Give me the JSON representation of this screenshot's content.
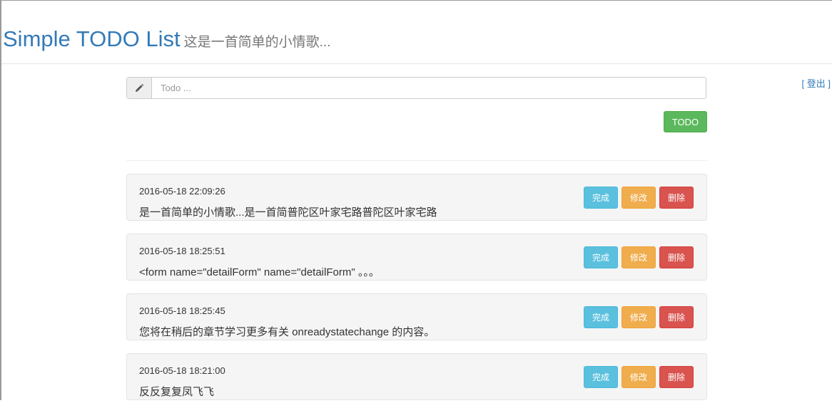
{
  "header": {
    "title": "Simple TODO List",
    "subtitle": "这是一首简单的小情歌..."
  },
  "nav": {
    "logout_label": "[ 登出 ]"
  },
  "form": {
    "input_placeholder": "Todo ...",
    "input_value": "",
    "input_icon": "pencil-icon",
    "submit_label": "TODO"
  },
  "todos": [
    {
      "time": "2016-05-18 22:09:26",
      "text": "是一首简单的小情歌...是一首简普陀区叶家宅路普陀区叶家宅路",
      "done_label": "完成",
      "edit_label": "修改",
      "delete_label": "删除"
    },
    {
      "time": "2016-05-18 18:25:51",
      "text": "<form name=\"detailForm\" name=\"detailForm\" 。。。",
      "done_label": "完成",
      "edit_label": "修改",
      "delete_label": "删除"
    },
    {
      "time": "2016-05-18 18:25:45",
      "text": "您将在稍后的章节学习更多有关 onreadystatechange 的内容。",
      "done_label": "完成",
      "edit_label": "修改",
      "delete_label": "删除"
    },
    {
      "time": "2016-05-18 18:21:00",
      "text": "反反复复凤飞飞",
      "done_label": "完成",
      "edit_label": "修改",
      "delete_label": "删除"
    }
  ],
  "colors": {
    "brand": "#337ab7",
    "success": "#5cb85c",
    "info": "#5bc0de",
    "warning": "#f0ad4e",
    "danger": "#d9534f"
  }
}
